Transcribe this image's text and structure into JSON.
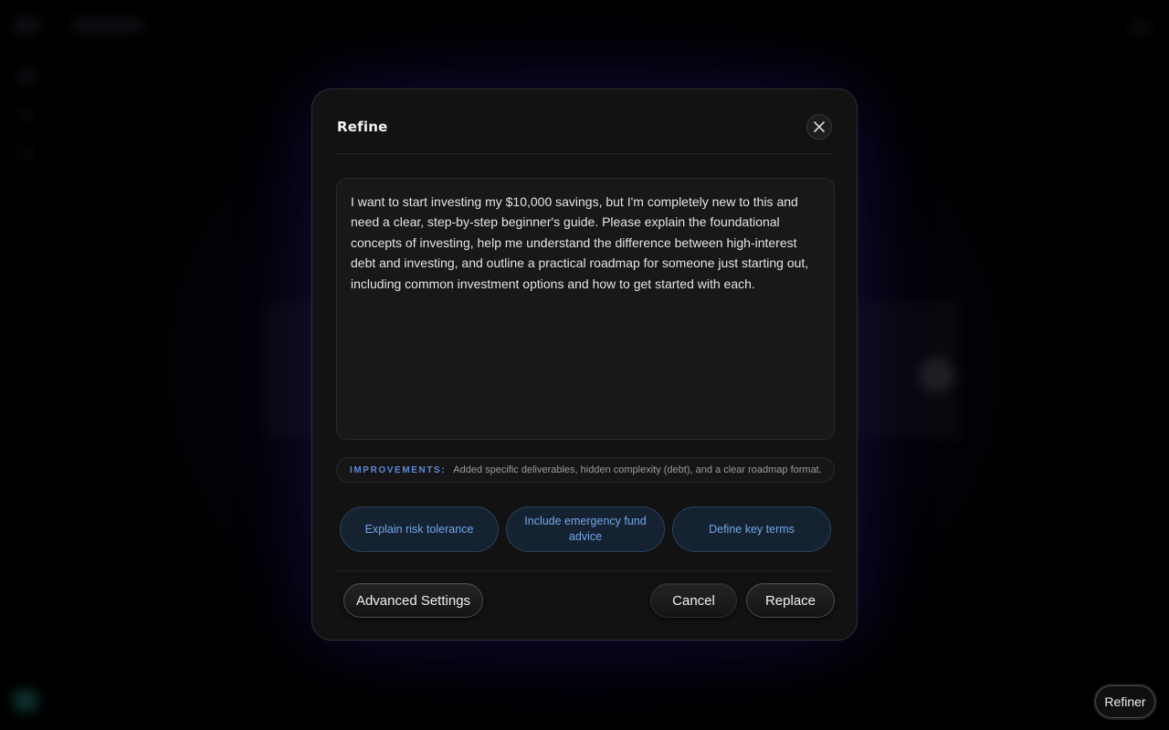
{
  "modal": {
    "title": "Refine",
    "close_icon": "close-icon",
    "prompt_text": "I want to start investing my $10,000 savings, but I'm completely new to this and need a clear, step-by-step beginner's guide. Please explain the foundational concepts of investing, help me understand the difference between high-interest debt and investing, and outline a practical roadmap for someone just starting out, including common investment options and how to get started with each.",
    "improvements": {
      "label": "IMPROVEMENTS:",
      "text": "Added specific deliverables, hidden complexity (debt), and a clear roadmap format."
    },
    "suggestions": [
      {
        "label": "Explain risk tolerance"
      },
      {
        "label": "Include emergency fund advice"
      },
      {
        "label": "Define key terms"
      }
    ],
    "footer": {
      "advanced_label": "Advanced Settings",
      "cancel_label": "Cancel",
      "replace_label": "Replace"
    }
  },
  "refiner_button": {
    "label": "Refiner"
  },
  "colors": {
    "accent_blue": "#72a7e8",
    "improvements_label": "#5b8ad6",
    "modal_bg": "#121212",
    "glow": "#1c1a5a"
  }
}
